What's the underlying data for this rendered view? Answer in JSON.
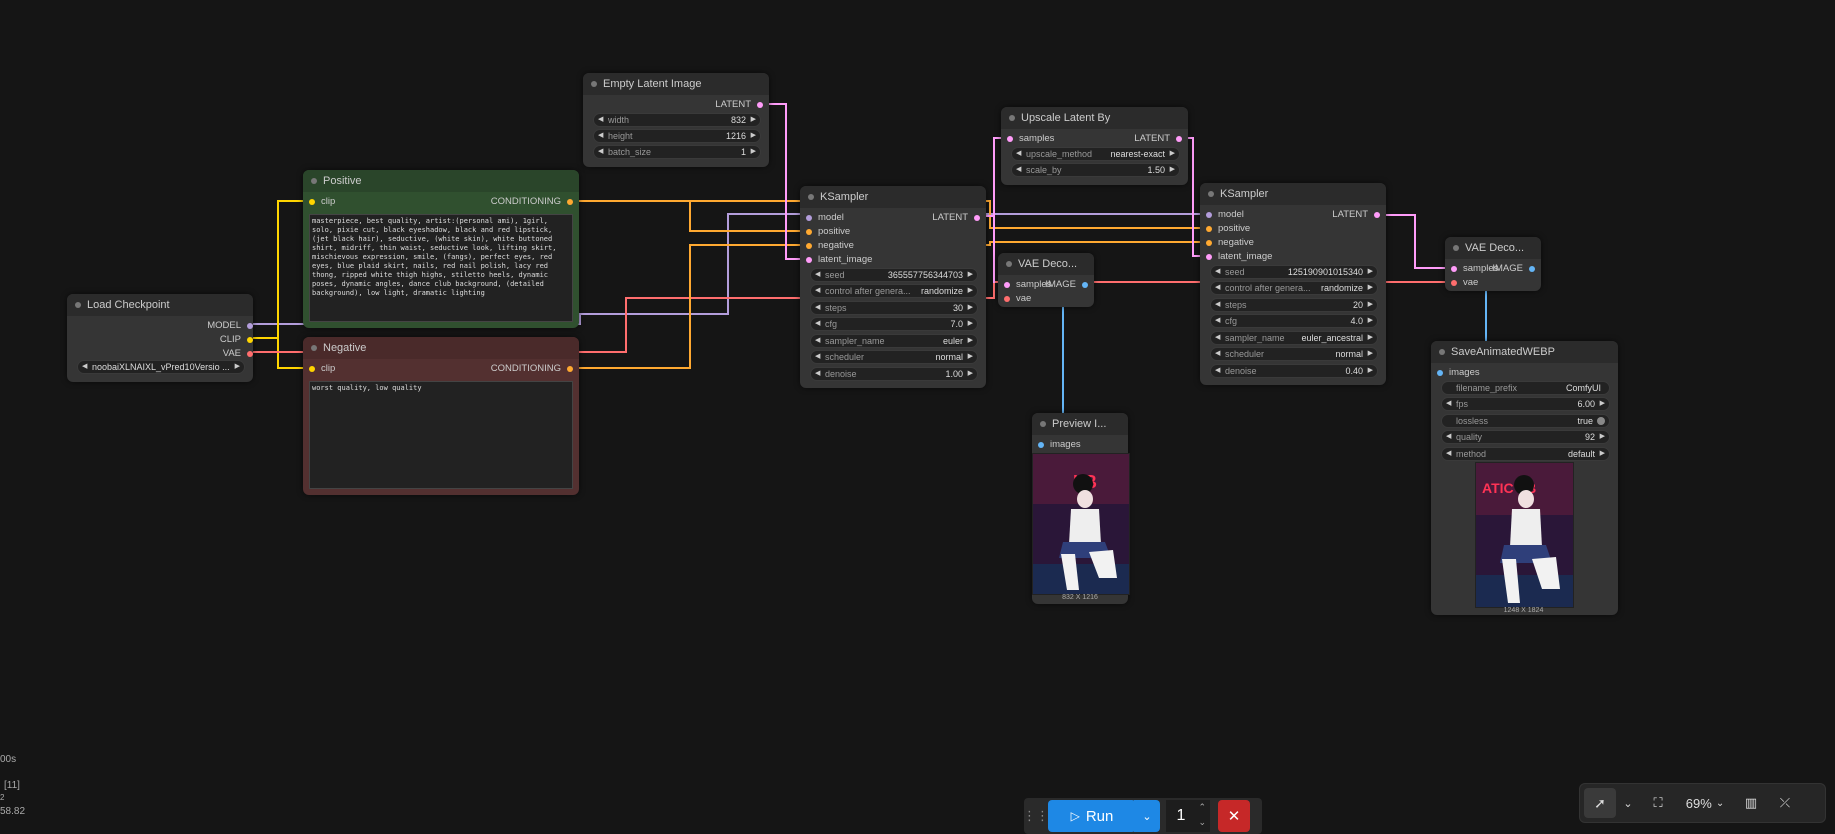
{
  "colors": {
    "model": "#b39ddb",
    "clip": "#ffd500",
    "vae": "#ff6e6e",
    "conditioning": "#ffa931",
    "latent": "#ff9cf9",
    "image": "#64b5f6",
    "accent": "#1e88e5"
  },
  "nodes": {
    "load_checkpoint": {
      "title": "Load Checkpoint",
      "out_model": "MODEL",
      "out_clip": "CLIP",
      "out_vae": "VAE",
      "ckpt_value": "noobaiXLNAIXL_vPred10Versio ..."
    },
    "positive": {
      "title": "Positive",
      "in_clip": "clip",
      "out_cond": "CONDITIONING",
      "text": "masterpiece, best quality, artist:(personal ami), 1girl, solo, pixie cut, black eyeshadow, black and red lipstick, (jet black hair), seductive, (white skin), white buttoned shirt, midriff, thin waist, seductive look, lifting skirt, mischievous expression, smile, (fangs), perfect eyes, red eyes, blue plaid skirt, nails, red nail polish, lacy red thong, ripped white thigh highs, stiletto heels, dynamic poses, dynamic angles, dance club background, (detailed background), low light, dramatic lighting"
    },
    "negative": {
      "title": "Negative",
      "in_clip": "clip",
      "out_cond": "CONDITIONING",
      "text": "worst quality, low quality"
    },
    "empty_latent": {
      "title": "Empty Latent Image",
      "out_latent": "LATENT",
      "width_label": "width",
      "width_value": "832",
      "height_label": "height",
      "height_value": "1216",
      "batch_label": "batch_size",
      "batch_value": "1"
    },
    "ksampler1": {
      "title": "KSampler",
      "in_model": "model",
      "in_positive": "positive",
      "in_negative": "negative",
      "in_latent": "latent_image",
      "out_latent": "LATENT",
      "widgets": [
        {
          "l": "seed",
          "v": "365557756344703"
        },
        {
          "l": "control after genera...",
          "v": "randomize"
        },
        {
          "l": "steps",
          "v": "30"
        },
        {
          "l": "cfg",
          "v": "7.0"
        },
        {
          "l": "sampler_name",
          "v": "euler"
        },
        {
          "l": "scheduler",
          "v": "normal"
        },
        {
          "l": "denoise",
          "v": "1.00"
        }
      ]
    },
    "upscale": {
      "title": "Upscale Latent By",
      "in_samples": "samples",
      "out_latent": "LATENT",
      "method_label": "upscale_method",
      "method_value": "nearest-exact",
      "scale_label": "scale_by",
      "scale_value": "1.50"
    },
    "vae_decode1": {
      "title": "VAE Deco...",
      "in_samples": "samples",
      "in_vae": "vae",
      "out_image": "IMAGE"
    },
    "preview": {
      "title": "Preview I...",
      "in_images": "images",
      "dims": "832 X 1216"
    },
    "ksampler2": {
      "title": "KSampler",
      "in_model": "model",
      "in_positive": "positive",
      "in_negative": "negative",
      "in_latent": "latent_image",
      "out_latent": "LATENT",
      "widgets": [
        {
          "l": "seed",
          "v": "125190901015340"
        },
        {
          "l": "control after genera...",
          "v": "randomize"
        },
        {
          "l": "steps",
          "v": "20"
        },
        {
          "l": "cfg",
          "v": "4.0"
        },
        {
          "l": "sampler_name",
          "v": "euler_ancestral"
        },
        {
          "l": "scheduler",
          "v": "normal"
        },
        {
          "l": "denoise",
          "v": "0.40"
        }
      ]
    },
    "vae_decode2": {
      "title": "VAE Deco...",
      "in_samples": "samples",
      "in_vae": "vae",
      "out_image": "IMAGE"
    },
    "save_webp": {
      "title": "SaveAnimatedWEBP",
      "in_images": "images",
      "widgets": [
        {
          "l": "filename_prefix",
          "v": "ComfyUI"
        },
        {
          "l": "fps",
          "v": "6.00"
        },
        {
          "l": "lossless",
          "v": "true"
        },
        {
          "l": "quality",
          "v": "92"
        },
        {
          "l": "method",
          "v": "default"
        }
      ],
      "dims": "1248 X 1824"
    }
  },
  "corner_stats": {
    "line1": "00s",
    "line2": "[11]",
    "line3": "2",
    "line4": "58.82"
  },
  "toolbar": {
    "run_label": "Run",
    "queue_count": "1"
  },
  "canvas_controls": {
    "zoom": "69%"
  }
}
